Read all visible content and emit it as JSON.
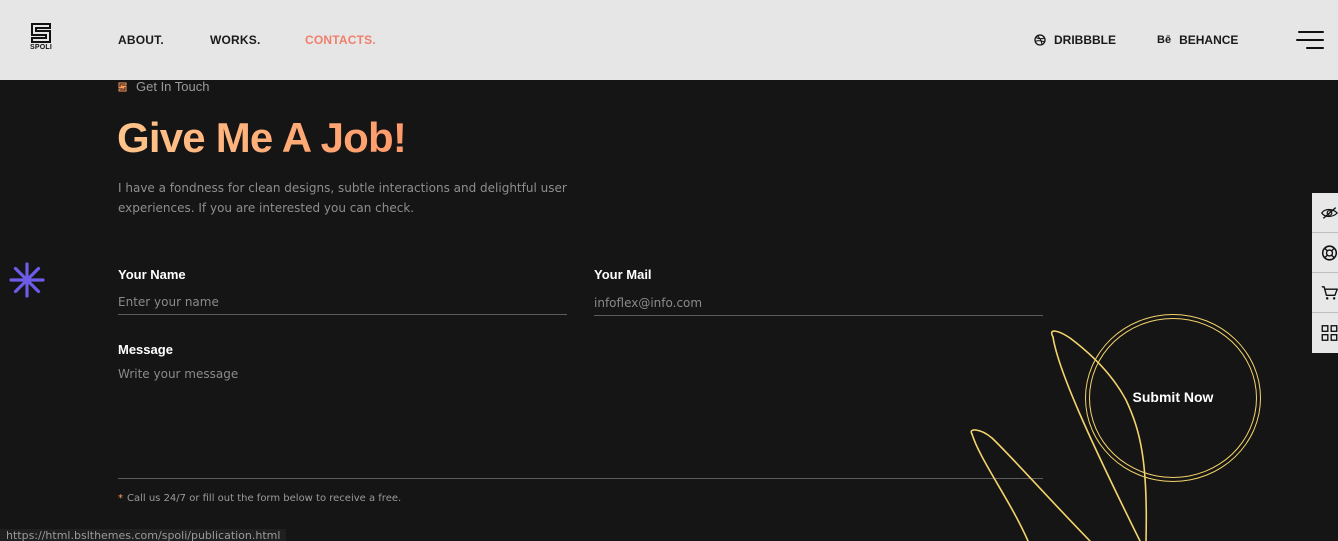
{
  "header": {
    "logo_text": "SPOLI",
    "nav": [
      {
        "label": "ABOUT."
      },
      {
        "label": "WORKS."
      },
      {
        "label": "CONTACTS."
      }
    ],
    "social": [
      {
        "label": "DRIBBBLE",
        "icon": "dribbble-icon"
      },
      {
        "label": "BEHANCE",
        "icon": "behance-icon",
        "glyph": "Bē"
      }
    ],
    "menu_icon": "hamburger-icon"
  },
  "hero": {
    "eyebrow": "Get In Touch",
    "headline": "Give Me A Job!",
    "intro": "I have a fondness for clean designs, subtle interactions and delightful user experiences. If you are interested you can check."
  },
  "form": {
    "name_label": "Your Name",
    "name_placeholder": "Enter your name",
    "mail_label": "Your Mail",
    "mail_placeholder": "infoflex@info.com",
    "message_label": "Message",
    "message_placeholder": "Write your message",
    "note_star": "*",
    "note": "Call us 24/7 or fill out the form below to receive a free.",
    "submit_label": "Submit Now"
  },
  "side_tools": [
    {
      "icon": "eye-off-icon"
    },
    {
      "icon": "lifebuoy-icon"
    },
    {
      "icon": "cart-icon"
    },
    {
      "icon": "grid-icon"
    }
  ],
  "status_bar_url": "https://html.bslthemes.com/spoli/publication.html",
  "colors": {
    "background": "#151515",
    "header_bg": "#e6e6e6",
    "accent_active": "#f07f6a",
    "headline_gradient_start": "#ffc48a",
    "headline_gradient_end": "#ff9a6a",
    "asterisk": "#6d5ce6",
    "swirl": "#f3d36b"
  }
}
